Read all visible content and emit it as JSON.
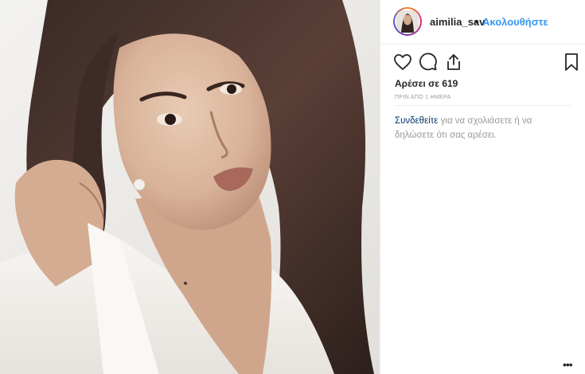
{
  "post": {
    "username": "aimilia_sav",
    "separator": "•",
    "follow_label": "Ακολουθήστε",
    "likes": "Αρέσει σε 619",
    "time_ago": "ΠΡΙΝ ΑΠΟ 1 ΗΜΕΡΑ",
    "login_link": "Συνδεθείτε",
    "login_text": " για να σχολιάσετε ή να δηλώσετε ότι σας αρέσει.",
    "more_label": "•••"
  },
  "icons": {
    "like": "heart-icon",
    "comment": "comment-icon",
    "share": "share-icon",
    "save": "bookmark-icon",
    "more": "more-options-icon"
  },
  "colors": {
    "follow": "#3897f0",
    "link": "#003569",
    "muted": "#999999",
    "text": "#262626"
  }
}
